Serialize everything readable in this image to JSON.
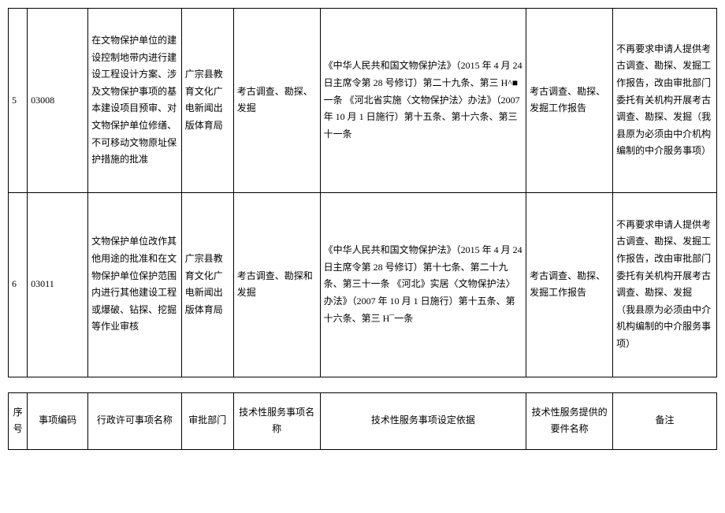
{
  "rows": [
    {
      "seq": "5",
      "code": "03008",
      "permit_name": "在文物保护单位的建设控制地带内进行建设工程设计方案、涉及文物保护事项的基本建设项目预审、对文物保护单位修缮、不可移动文物原址保护措施的批准",
      "dept": "广宗县教育文化广电新闻出版体育局",
      "svc_name": "考古调查、勘探、发掘",
      "basis": "《中华人民共和国文物保护法》（2015 年 4 月 24 日主席令第 28 号修订）第二十九条、第三 H^■一条\n《河北省实施〈文物保护法〉办法》（2007 年 10 月 1 日施行）第十五条、第十六条、第三十一条",
      "doc": "考古调查、勘探、发掘工作报告",
      "remark": "不再要求申请人提供考古调查、勘探、发掘工作报告，改由审批部门委托有关机构开展考古调查、勘探、发掘（我县原为必须由中介机构编制的中介服务事项）"
    },
    {
      "seq": "6",
      "code": "03011",
      "permit_name": "文物保护单位改作其他用途的批准和在文物保护单位保护范围内进行其他建设工程或爆破、钻探、挖掘等作业审核",
      "dept": "广宗县教育文化广电新闻出版体育局",
      "svc_name": "考古调查、勘探和发掘",
      "basis": "《中华人民共和国文物保护法》（2015 年 4 月 24 日主席令第 28 号修订）第十七条、第二十九条、第三十一条\n《河北》实居〈文物保护法〉办法》（2007 年 10 月 1 日施行）第十五条、第十六条、第三 H¯一条",
      "doc": "考古调查、勘探、发掘工作报告",
      "remark": "不再要求申请人提供考古调查、勘探、发掘工作报告，改由审批部门委托有关机构开展考古调查、勘探、发掘\n（我县原为必须由中介机构编制的中介服务事项）"
    }
  ],
  "headers": {
    "seq": "序号",
    "code": "事项编码",
    "permit_name": "行政许可事项名称",
    "dept": "审批部门",
    "svc_name": "技术性服务事项名称",
    "basis": "技术性服务事项设定依据",
    "doc": "技术性服务提供的要件名称",
    "remark": "备注"
  }
}
